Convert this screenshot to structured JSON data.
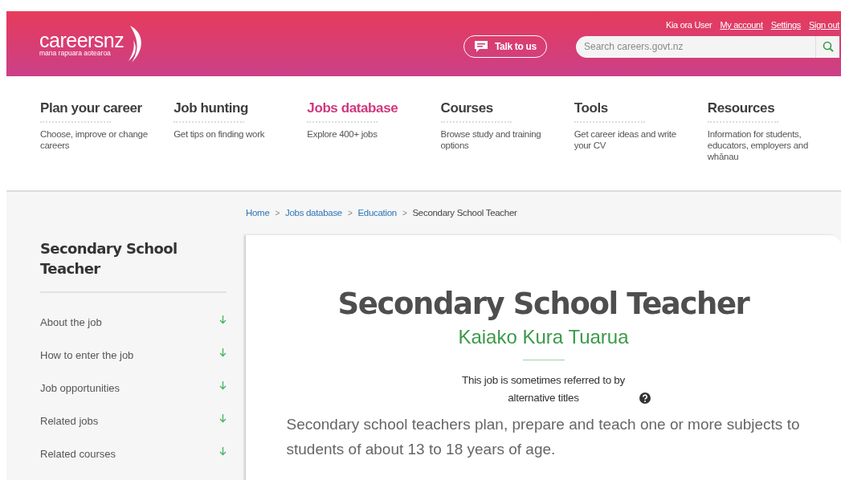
{
  "header": {
    "logo": {
      "name": "careersnz",
      "tagline": "mana rapuara aotearoa"
    },
    "greeting": "Kia ora User",
    "account_links": [
      "My account",
      "Settings",
      "Sign out"
    ],
    "talk_button": "Talk to us",
    "search": {
      "placeholder": "Search careers.govt.nz"
    }
  },
  "nav": [
    {
      "title": "Plan your career",
      "description": "Choose, improve or change careers",
      "selected": false
    },
    {
      "title": "Job hunting",
      "description": "Get tips on finding work",
      "selected": false
    },
    {
      "title": "Jobs database",
      "description": "Explore 400+ jobs",
      "selected": true
    },
    {
      "title": "Courses",
      "description": "Browse study and training options",
      "selected": false
    },
    {
      "title": "Tools",
      "description": "Get career ideas and write your CV",
      "selected": false
    },
    {
      "title": "Resources",
      "description": "Information for students, educators, employers and whānau",
      "selected": false
    }
  ],
  "breadcrumb_separator": ">",
  "breadcrumb": [
    {
      "label": "Home",
      "kind": "link"
    },
    {
      "label": "Jobs database",
      "kind": "link"
    },
    {
      "label": "Education",
      "kind": "link"
    },
    {
      "label": "Secondary School Teacher",
      "kind": "current"
    }
  ],
  "sidebar": {
    "title": "Secondary School Teacher",
    "items": [
      "About the job",
      "How to enter the job",
      "Job opportunities",
      "Related jobs",
      "Related courses"
    ]
  },
  "main": {
    "title": "Secondary School Teacher",
    "maori_title": "Kaiako Kura Tuarua",
    "alt_titles_note": "This job is sometimes referred to by alternative titles",
    "summary": "Secondary school teachers plan, prepare and teach one or more subjects to students of about 13 to 18 years of age."
  }
}
